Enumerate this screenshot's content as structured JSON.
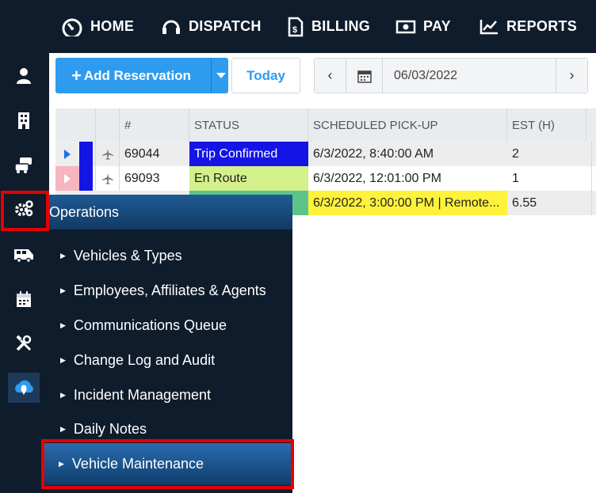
{
  "topnav": {
    "items": [
      {
        "label": "HOME",
        "icon": "dashboard-gauge-icon"
      },
      {
        "label": "DISPATCH",
        "icon": "headset-icon"
      },
      {
        "label": "BILLING",
        "icon": "invoice-icon"
      },
      {
        "label": "PAY",
        "icon": "cash-icon"
      },
      {
        "label": "REPORTS",
        "icon": "line-chart-icon"
      }
    ]
  },
  "siderail": {
    "icons": [
      "user-icon",
      "building-icon",
      "cars-icon",
      "gears-icon",
      "shuttle-bus-icon",
      "calendar-icon",
      "tools-icon",
      "cloud-location-icon"
    ],
    "selected": "gears-icon"
  },
  "toolbar": {
    "add_label": "Add Reservation",
    "add_plus": "+",
    "today_label": "Today",
    "prev_symbol": "‹",
    "next_symbol": "›",
    "date_value": "06/03/2022"
  },
  "grid": {
    "headers": [
      "#",
      "STATUS",
      "SCHEDULED PICK-UP",
      "EST (H)"
    ],
    "rows": [
      {
        "num": "69044",
        "status": "Trip Confirmed",
        "status_color": "#1414e6",
        "status_text_color": "#ffffff",
        "pickup": "6/3/2022, 8:40:00 AM",
        "pickup_color": "",
        "est": "2",
        "marker_color": "#1a73e8"
      },
      {
        "num": "69093",
        "status": "En Route",
        "status_color": "#d4f08a",
        "status_text_color": "#222222",
        "pickup": "6/3/2022, 12:01:00 PM",
        "pickup_color": "",
        "est": "1",
        "marker_color": "#f58ea0"
      },
      {
        "num": "",
        "status": "",
        "status_color": "#5cc48a",
        "status_text_color": "#222222",
        "pickup": "6/3/2022, 3:00:00 PM | Remote...",
        "pickup_color": "#fff23a",
        "est": "6.55",
        "marker_color": "#1a73e8"
      }
    ]
  },
  "operations_menu": {
    "title": "Operations",
    "items": [
      "Vehicles & Types",
      "Employees, Affiliates & Agents",
      "Communications Queue",
      "Change Log and Audit",
      "Incident Management",
      "Daily Notes"
    ],
    "active_item": "Vehicle Maintenance"
  },
  "colors": {
    "nav_bg": "#0f1c2c",
    "accent": "#2e9bef",
    "highlight": "#e60000"
  }
}
